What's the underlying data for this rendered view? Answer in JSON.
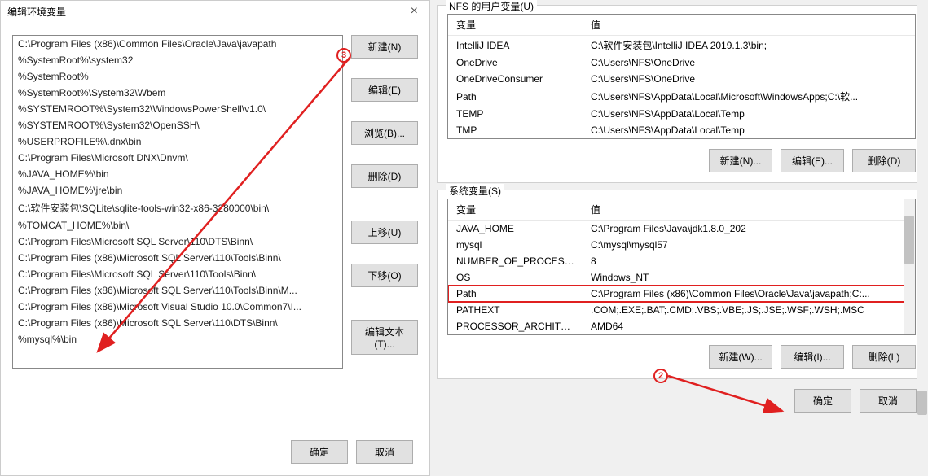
{
  "left": {
    "title": "编辑环境变量",
    "paths": [
      "C:\\Program Files (x86)\\Common Files\\Oracle\\Java\\javapath",
      "%SystemRoot%\\system32",
      "%SystemRoot%",
      "%SystemRoot%\\System32\\Wbem",
      "%SYSTEMROOT%\\System32\\WindowsPowerShell\\v1.0\\",
      "%SYSTEMROOT%\\System32\\OpenSSH\\",
      "%USERPROFILE%\\.dnx\\bin",
      "C:\\Program Files\\Microsoft DNX\\Dnvm\\",
      "%JAVA_HOME%\\bin",
      "%JAVA_HOME%\\jre\\bin",
      "C:\\软件安装包\\SQLite\\sqlite-tools-win32-x86-3280000\\bin\\",
      "%TOMCAT_HOME%\\bin\\",
      "C:\\Program Files\\Microsoft SQL Server\\110\\DTS\\Binn\\",
      "C:\\Program Files (x86)\\Microsoft SQL Server\\110\\Tools\\Binn\\",
      "C:\\Program Files\\Microsoft SQL Server\\110\\Tools\\Binn\\",
      "C:\\Program Files (x86)\\Microsoft SQL Server\\110\\Tools\\Binn\\M...",
      "C:\\Program Files (x86)\\Microsoft Visual Studio 10.0\\Common7\\I...",
      "C:\\Program Files (x86)\\Microsoft SQL Server\\110\\DTS\\Binn\\",
      "%mysql%\\bin"
    ],
    "buttons": {
      "new": "新建(N)",
      "edit": "编辑(E)",
      "browse": "浏览(B)...",
      "delete": "删除(D)",
      "moveup": "上移(U)",
      "movedown": "下移(O)",
      "edittext": "编辑文本(T)..."
    },
    "ok": "确定",
    "cancel": "取消"
  },
  "userVars": {
    "title": "NFS 的用户变量(U)",
    "headers": {
      "var": "变量",
      "val": "值"
    },
    "rows": [
      {
        "k": "IntelliJ IDEA",
        "v": "C:\\软件安装包\\IntelliJ IDEA 2019.1.3\\bin;"
      },
      {
        "k": "OneDrive",
        "v": "C:\\Users\\NFS\\OneDrive"
      },
      {
        "k": "OneDriveConsumer",
        "v": "C:\\Users\\NFS\\OneDrive"
      },
      {
        "k": "Path",
        "v": "C:\\Users\\NFS\\AppData\\Local\\Microsoft\\WindowsApps;C:\\软..."
      },
      {
        "k": "TEMP",
        "v": "C:\\Users\\NFS\\AppData\\Local\\Temp"
      },
      {
        "k": "TMP",
        "v": "C:\\Users\\NFS\\AppData\\Local\\Temp"
      }
    ],
    "buttons": {
      "new": "新建(N)...",
      "edit": "编辑(E)...",
      "delete": "删除(D)"
    }
  },
  "sysVars": {
    "title": "系统变量(S)",
    "headers": {
      "var": "变量",
      "val": "值"
    },
    "rows": [
      {
        "k": "JAVA_HOME",
        "v": "C:\\Program Files\\Java\\jdk1.8.0_202"
      },
      {
        "k": "mysql",
        "v": "C:\\mysql\\mysql57"
      },
      {
        "k": "NUMBER_OF_PROCESSORS",
        "v": "8"
      },
      {
        "k": "OS",
        "v": "Windows_NT"
      },
      {
        "k": "Path",
        "v": "C:\\Program Files (x86)\\Common Files\\Oracle\\Java\\javapath;C:...",
        "hl": true
      },
      {
        "k": "PATHEXT",
        "v": ".COM;.EXE;.BAT;.CMD;.VBS;.VBE;.JS;.JSE;.WSF;.WSH;.MSC"
      },
      {
        "k": "PROCESSOR_ARCHITECT...",
        "v": "AMD64"
      }
    ],
    "buttons": {
      "new": "新建(W)...",
      "edit": "编辑(I)...",
      "delete": "删除(L)"
    }
  },
  "footer": {
    "ok": "确定",
    "cancel": "取消"
  },
  "annot": {
    "n2": "2",
    "n3": "3"
  }
}
